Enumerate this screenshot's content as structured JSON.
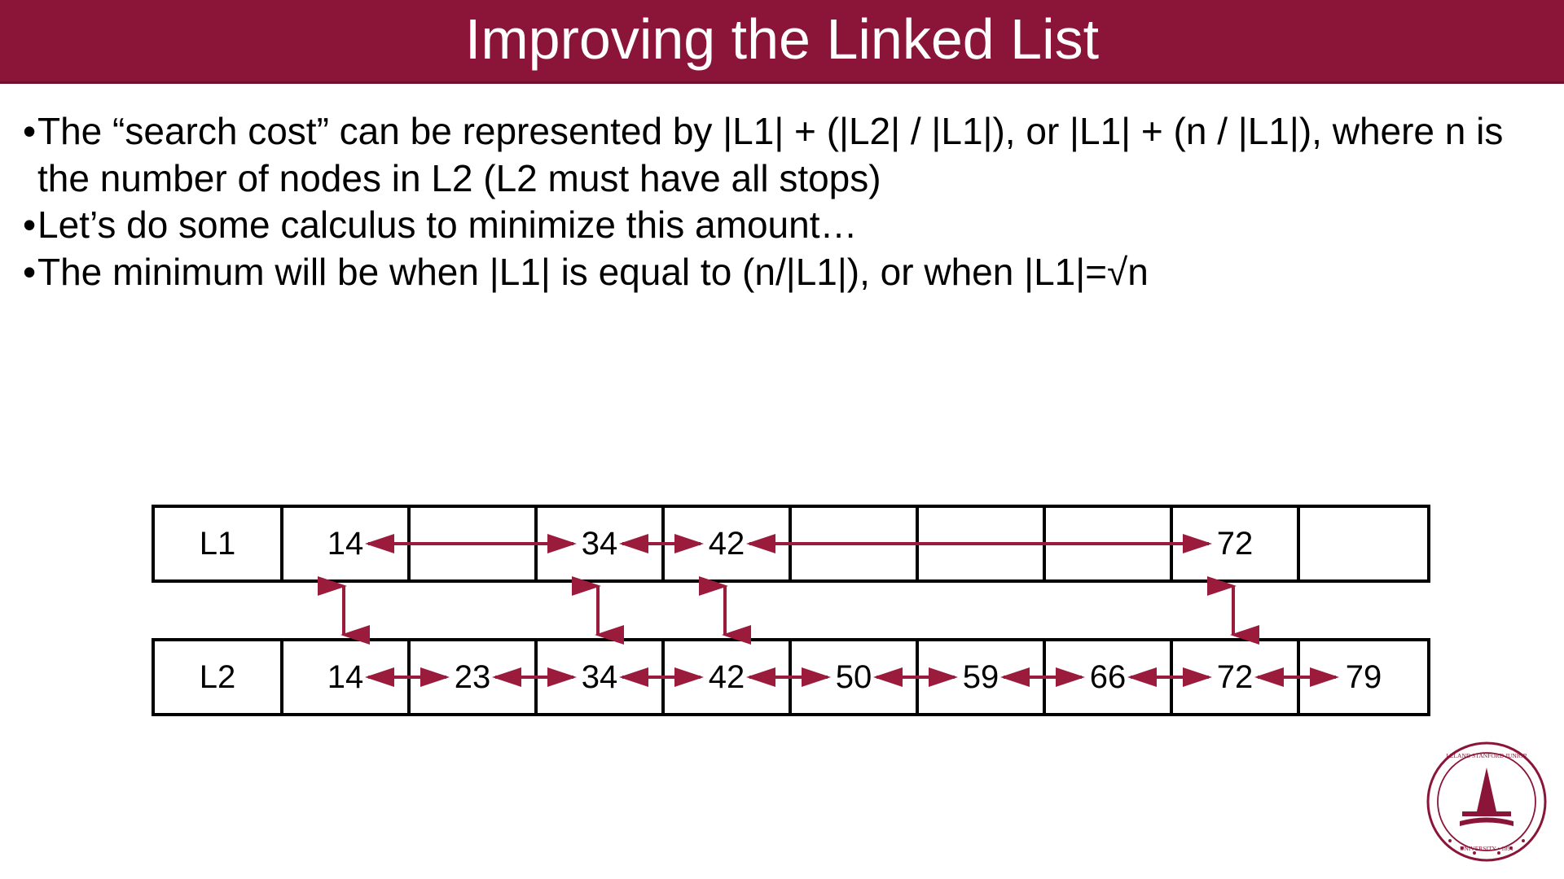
{
  "title": "Improving the Linked List",
  "bullets": [
    "The “search cost” can be represented by |L1| + (|L2| / |L1|), or |L1| + (n / |L1|), where n is the number of nodes in L2 (L2 must have all stops)",
    "Let’s do some calculus to minimize this amount…",
    "The minimum will be when |L1| is equal to (n/|L1|), or when |L1|=√n"
  ],
  "lists": {
    "L1": {
      "label": "L1",
      "cells": [
        "14",
        "",
        "34",
        "42",
        "",
        "",
        "",
        "72",
        ""
      ]
    },
    "L2": {
      "label": "L2",
      "cells": [
        "14",
        "23",
        "34",
        "42",
        "50",
        "59",
        "66",
        "72",
        "79"
      ]
    }
  },
  "colors": {
    "accent": "#8a1538",
    "arrow": "#9a1b3b"
  },
  "chart_data": {
    "type": "table",
    "title": "Skip list two-level example",
    "series": [
      {
        "name": "L1",
        "values": [
          14,
          null,
          34,
          42,
          null,
          null,
          null,
          72,
          null
        ]
      },
      {
        "name": "L2",
        "values": [
          14,
          23,
          34,
          42,
          50,
          59,
          66,
          72,
          79
        ]
      }
    ],
    "vertical_links_at_indices": [
      0,
      2,
      3,
      7
    ],
    "l1_horizontal_links": [
      [
        0,
        2
      ],
      [
        2,
        3
      ],
      [
        3,
        7
      ]
    ],
    "l2_horizontal_links": [
      [
        0,
        1
      ],
      [
        1,
        2
      ],
      [
        2,
        3
      ],
      [
        3,
        4
      ],
      [
        4,
        5
      ],
      [
        5,
        6
      ],
      [
        6,
        7
      ],
      [
        7,
        8
      ]
    ]
  }
}
